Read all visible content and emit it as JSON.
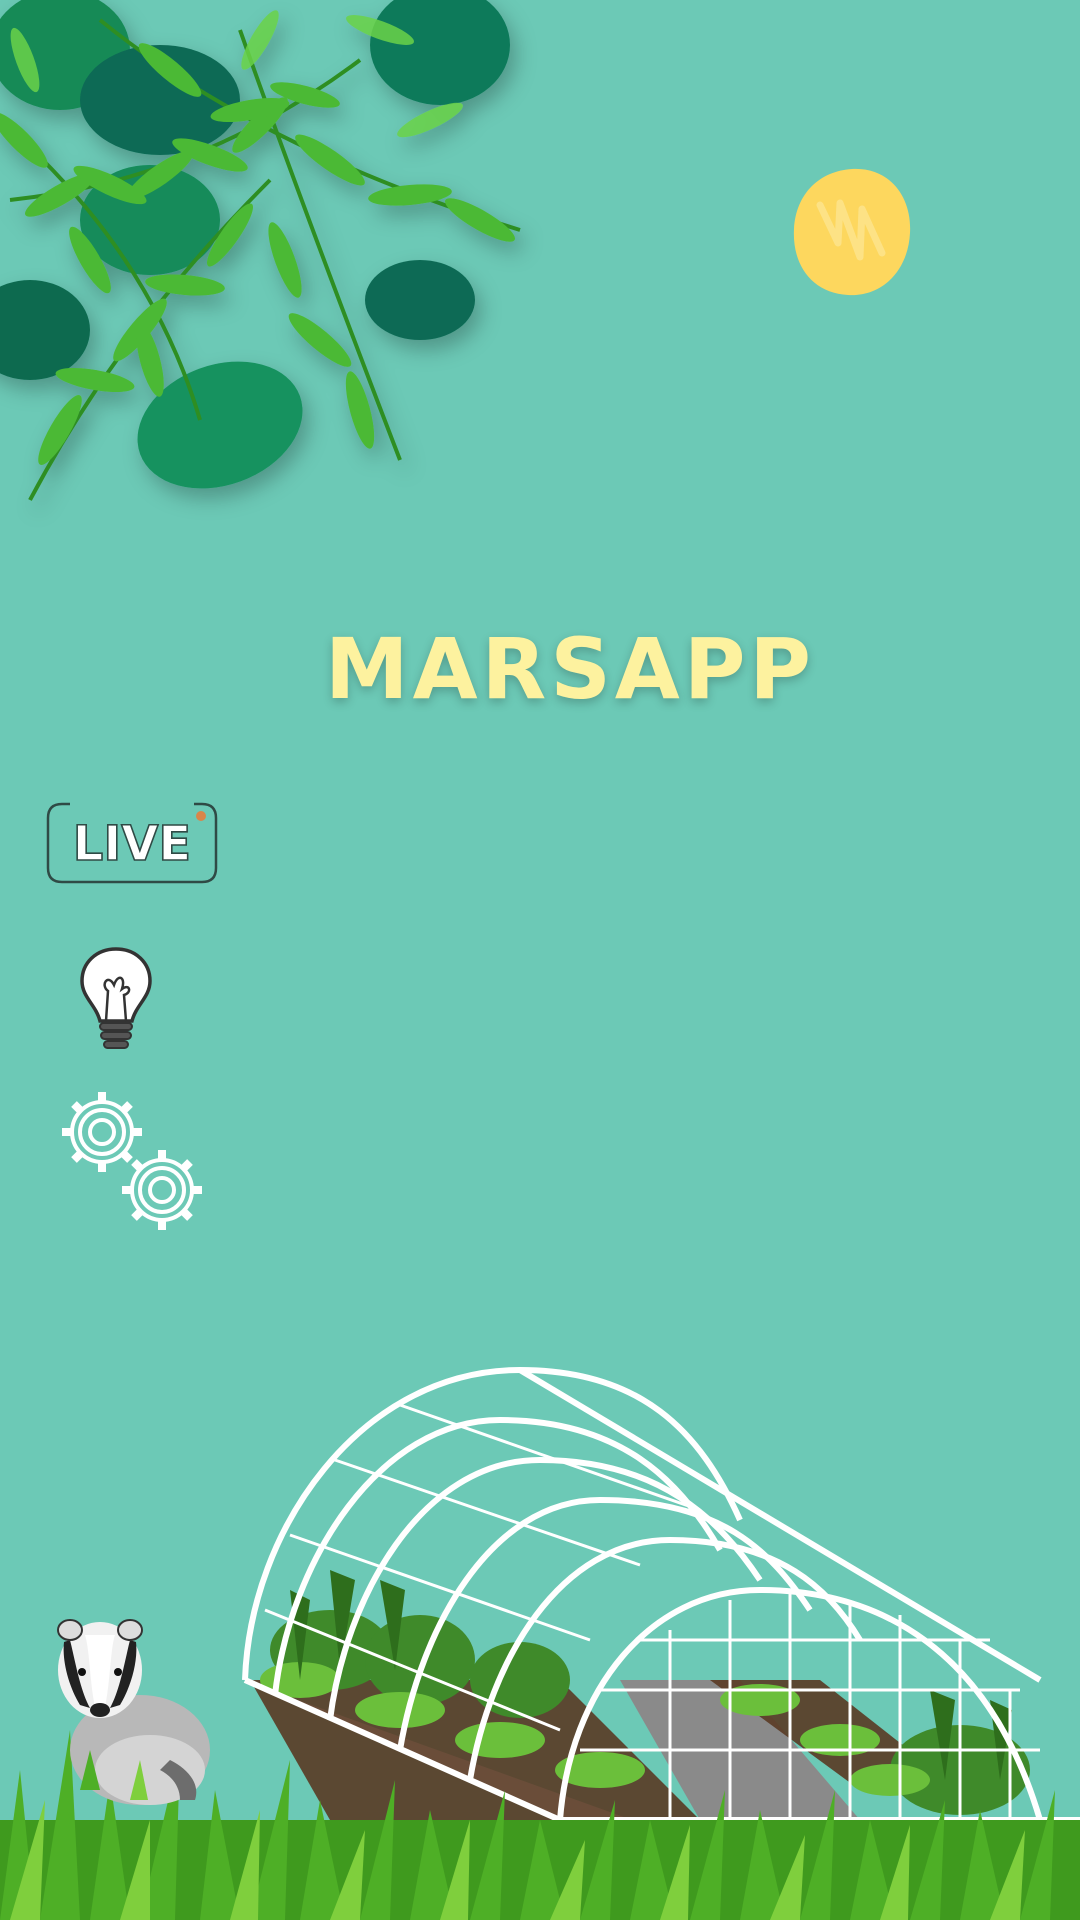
{
  "app": {
    "title": "MARSAPP"
  },
  "menu": {
    "live_label": "LIVE",
    "items": [
      {
        "name": "live-button",
        "icon": "live-icon"
      },
      {
        "name": "idea-button",
        "icon": "lightbulb-icon"
      },
      {
        "name": "settings-button",
        "icon": "gears-icon"
      }
    ]
  },
  "decor": {
    "foliage": "tropical-leaves",
    "sun": "sun-icon",
    "greenhouse": "greenhouse-illustration",
    "animal": "badger",
    "ground": "grass"
  },
  "colors": {
    "background": "#6cc9b6",
    "title": "#fdf29f",
    "sun": "#fdd75e",
    "leaf_light": "#4cb936",
    "leaf_dark": "#0f7a5a",
    "grass": "#3f9a1e"
  }
}
